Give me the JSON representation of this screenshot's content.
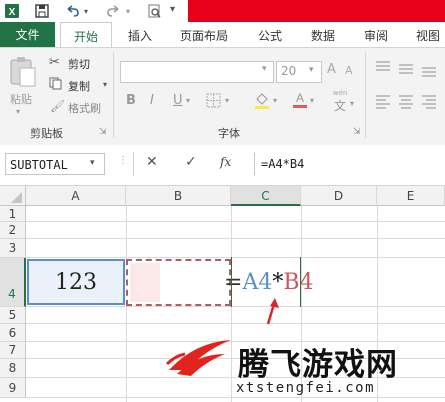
{
  "qat": {
    "excel_icon": "excel-logo-icon",
    "save_icon": "save-icon",
    "undo_icon": "undo-icon",
    "redo_icon": "redo-icon",
    "print_preview_icon": "print-preview-icon",
    "customize_icon": "customize-qat-icon"
  },
  "tabs": {
    "file": "文件",
    "home": "开始",
    "insert": "插入",
    "page_layout": "页面布局",
    "formulas": "公式",
    "data": "数据",
    "review": "审阅",
    "view": "视图"
  },
  "ribbon": {
    "clipboard": {
      "paste": "粘贴",
      "cut": "剪切",
      "copy": "复制",
      "format_painter": "格式刷",
      "group_label": "剪贴板"
    },
    "font": {
      "font_name": "",
      "font_size": "20",
      "bold": "B",
      "italic": "I",
      "underline": "U",
      "wen": "文",
      "group_label": "字体"
    }
  },
  "formula_bar": {
    "name_box": "SUBTOTAL",
    "cancel": "✕",
    "enter": "✓",
    "fx": "fx",
    "formula": "=A4*B4"
  },
  "grid": {
    "columns": [
      "A",
      "B",
      "C",
      "D",
      "E"
    ],
    "rows": [
      "1",
      "2",
      "3",
      "4",
      "5",
      "6",
      "7",
      "8",
      "9"
    ],
    "a4_value": "123",
    "c4_eq": "=",
    "c4_ref_a": "A4",
    "c4_op": "*",
    "c4_ref_b": "B4"
  },
  "watermark": {
    "brand": "腾飞游戏网",
    "url": "xtstengfei.com"
  },
  "colors": {
    "excel_green": "#217346",
    "ref_blue": "#5b8fc9",
    "ref_red": "#d0555a",
    "banner_red": "#e8001a"
  }
}
